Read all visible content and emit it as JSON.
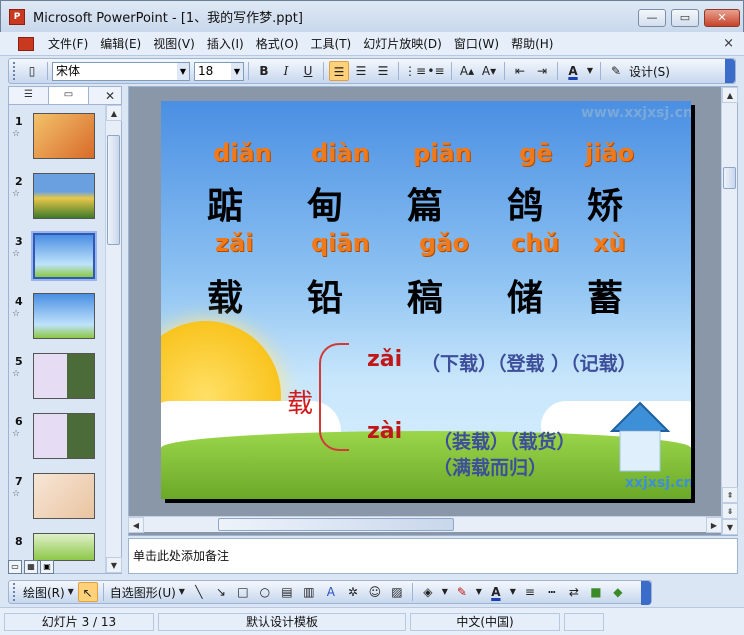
{
  "window": {
    "title": "Microsoft PowerPoint - [1、我的写作梦.ppt]",
    "min_symbol": "—",
    "max_symbol": "▭",
    "close_symbol": "✕"
  },
  "menu": {
    "items": [
      "文件(F)",
      "编辑(E)",
      "视图(V)",
      "插入(I)",
      "格式(O)",
      "工具(T)",
      "幻灯片放映(D)",
      "窗口(W)",
      "帮助(H)"
    ],
    "close_symbol": "×"
  },
  "toolbar": {
    "font_name": "宋体",
    "font_size": "18",
    "bold": "B",
    "italic": "I",
    "underline": "U",
    "design_label": "设计(S)"
  },
  "thumbnails": {
    "numbers": [
      "1",
      "2",
      "3",
      "4",
      "5",
      "6",
      "7",
      "8"
    ],
    "selected_index": 3,
    "star": "☆"
  },
  "slide": {
    "row1_pinyin": [
      "diǎn",
      "diàn",
      "piān",
      "gē",
      "jiǎo"
    ],
    "row1_chars": [
      "踮",
      "甸",
      "篇",
      "鸽",
      "矫"
    ],
    "row2_pinyin": [
      "zǎi",
      "qiān",
      "gǎo",
      "chǔ",
      "xù"
    ],
    "row2_chars": [
      "载",
      "铅",
      "稿",
      "储",
      "蓄"
    ],
    "center_char": "载",
    "zai3": "zǎi",
    "zai3_words": "（下载）（登载 ）（记载）",
    "zai4": "zài",
    "zai4_words_1": "（装载）（载货）",
    "zai4_words_2": "（满载而归）",
    "watermark_top": "www.xxjxsj.cn",
    "watermark_bottom": "xxjxsj.cn"
  },
  "notes": {
    "placeholder": "单击此处添加备注"
  },
  "drawbar": {
    "draw_label": "绘图(R)",
    "autoshape_label": "自选图形(U)"
  },
  "status": {
    "slide_pos": "幻灯片 3 / 13",
    "template": "默认设计模板",
    "language": "中文(中国)"
  },
  "colors": {
    "pinyin": "#f07a1a",
    "accent_red": "#c01818",
    "words_blue": "#3d4f9a",
    "chrome": "#dbe6f5"
  }
}
